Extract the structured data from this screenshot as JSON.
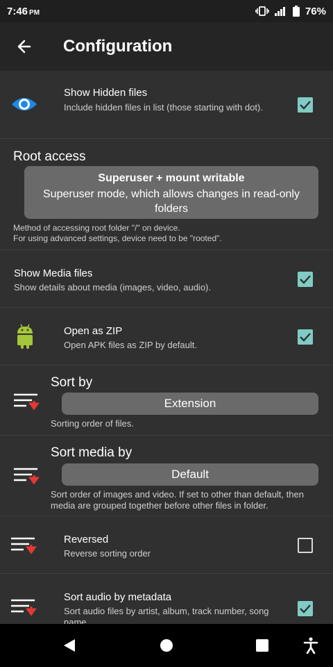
{
  "status": {
    "time": "7:46",
    "ampm": "PM",
    "battery": "76%"
  },
  "toolbar": {
    "title": "Configuration"
  },
  "settings": {
    "hidden": {
      "title": "Show Hidden files",
      "summary": "Include hidden files in list (those starting with dot).",
      "checked": true
    },
    "root": {
      "title": "Root access",
      "value_title": "Superuser + mount writable",
      "value_desc": "Superuser mode, which allows changes in read-only folders",
      "summary_line1": "Method of accessing root folder \"/\" on device.",
      "summary_line2": "For using advanced settings, device need to be \"rooted\"."
    },
    "media": {
      "title": "Show Media files",
      "summary": "Show details about media (images, video, audio).",
      "checked": true
    },
    "zip": {
      "title": "Open as ZIP",
      "summary": "Open APK files as ZIP by default.",
      "checked": true
    },
    "sort": {
      "title": "Sort by",
      "value": "Extension",
      "summary": "Sorting order of files."
    },
    "sort_media": {
      "title": "Sort media by",
      "value": "Default",
      "summary": "Sort order of images and video. If set to other than default, then media are grouped together before other files in folder."
    },
    "reversed": {
      "title": "Reversed",
      "summary": "Reverse sorting order",
      "checked": false
    },
    "audio": {
      "title": "Sort audio by metadata",
      "summary": "Sort audio files by artist, album, track number, song name.",
      "checked": true
    }
  },
  "icons": {
    "hidden": "eye-icon",
    "zip": "android-icon",
    "sort": "sort-icon"
  },
  "colors": {
    "accent": "#80cbc4",
    "sort_arrow": "#e53935",
    "eye": "#1e88e5",
    "android": "#a4c639"
  }
}
